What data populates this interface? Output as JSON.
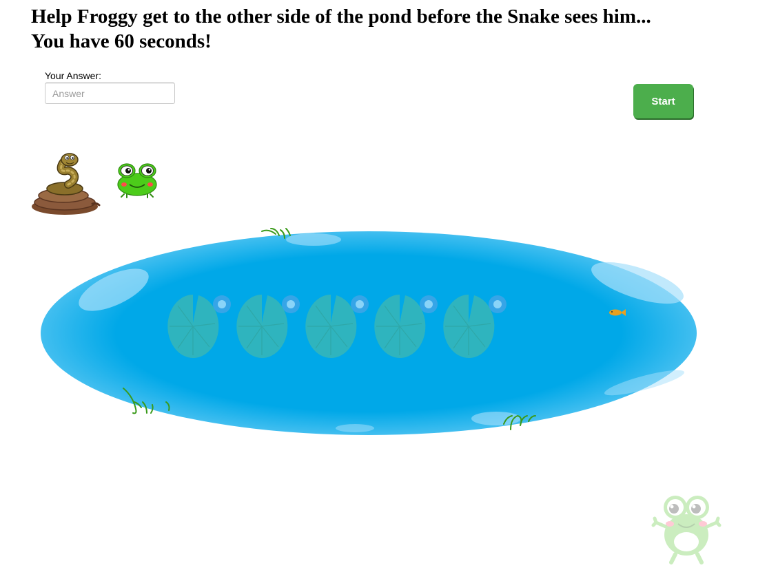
{
  "game": {
    "headline_line1": "Help Froggy get to the other side of the pond before the Snake sees him...",
    "headline_line2": "You have 60 seconds!"
  },
  "answer": {
    "label": "Your Answer:",
    "value": "",
    "placeholder": "Answer"
  },
  "controls": {
    "start_label": "Start"
  },
  "sprites": {
    "snake": "snake-icon",
    "frog": "frog-icon",
    "pond": "pond-icon",
    "lily_pads": [
      "lily-pad-icon",
      "lily-pad-icon",
      "lily-pad-icon",
      "lily-pad-icon",
      "lily-pad-icon"
    ],
    "fish": "fish-icon",
    "grass": [
      "grass-icon",
      "grass-icon",
      "grass-icon"
    ],
    "goal_frog": "frog-icon"
  },
  "colors": {
    "water": "#00a8e8",
    "water_highlight": "#a6e0fb",
    "lily_pad": "#3fb8b0",
    "lily_flower": "#3fa5e6",
    "fish": "#e8a020",
    "grass": "#3a9a1a",
    "frog_green": "#4ccc1a",
    "start_button": "#4cae4c",
    "snake_body": "#8a6f2a",
    "snake_coil": "#8b5a3c"
  }
}
